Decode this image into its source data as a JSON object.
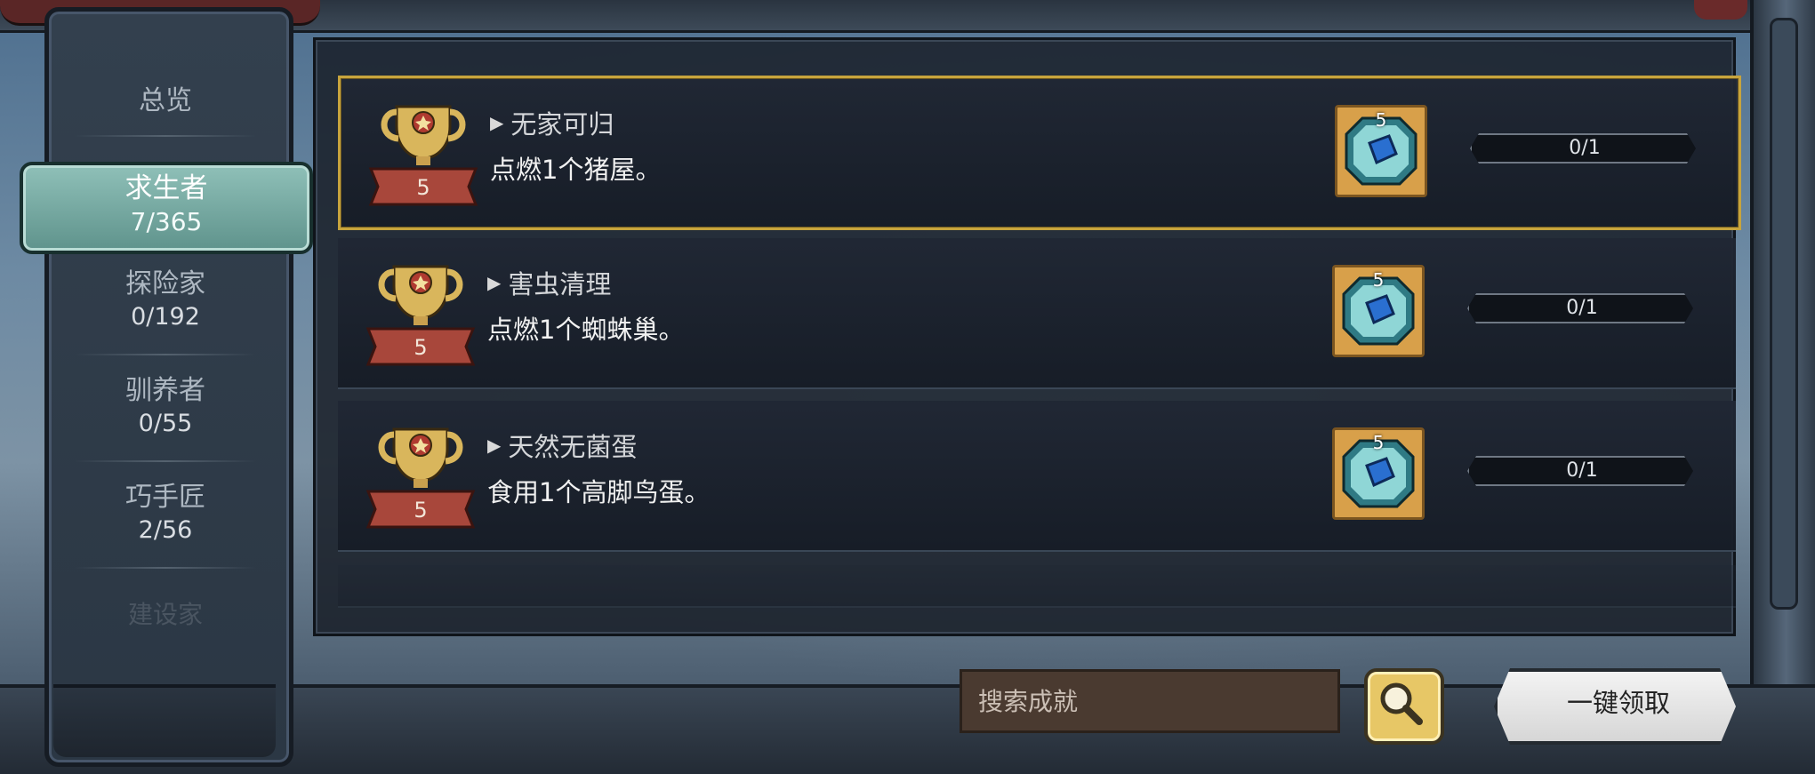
{
  "sidebar": {
    "overview_label": "总览",
    "active": {
      "name": "求生者",
      "count": "7/365"
    },
    "items": [
      {
        "name": "探险家",
        "count": "0/192"
      },
      {
        "name": "驯养者",
        "count": "0/55"
      },
      {
        "name": "巧手匠",
        "count": "2/56"
      }
    ],
    "faded_label": "建设家"
  },
  "achievements": [
    {
      "level": "5",
      "title": "无家可归",
      "desc": "点燃1个猪屋。",
      "reward_count": "5",
      "progress": "0/1",
      "progress_fraction": 0,
      "selected": true
    },
    {
      "level": "5",
      "title": "害虫清理",
      "desc": "点燃1个蜘蛛巢。",
      "reward_count": "5",
      "progress": "0/1",
      "progress_fraction": 0,
      "selected": false
    },
    {
      "level": "5",
      "title": "天然无菌蛋",
      "desc": "食用1个高脚鸟蛋。",
      "reward_count": "5",
      "progress": "0/1",
      "progress_fraction": 0,
      "selected": false
    }
  ],
  "search": {
    "placeholder": "搜索成就",
    "value": ""
  },
  "claim_all_label": "一键领取",
  "icons": {
    "trophy": "trophy-icon",
    "reward": "gem-icon",
    "search": "magnifier-icon",
    "title_arrow": "play-triangle-icon"
  },
  "colors": {
    "selected_border": "#c7a43d",
    "active_tab": "#6fa39b",
    "trophy_cup": "#d9b65c",
    "trophy_ribbon": "#a8473b",
    "reward_bg": "#d8a04a",
    "gem": "#2a6fd0"
  }
}
